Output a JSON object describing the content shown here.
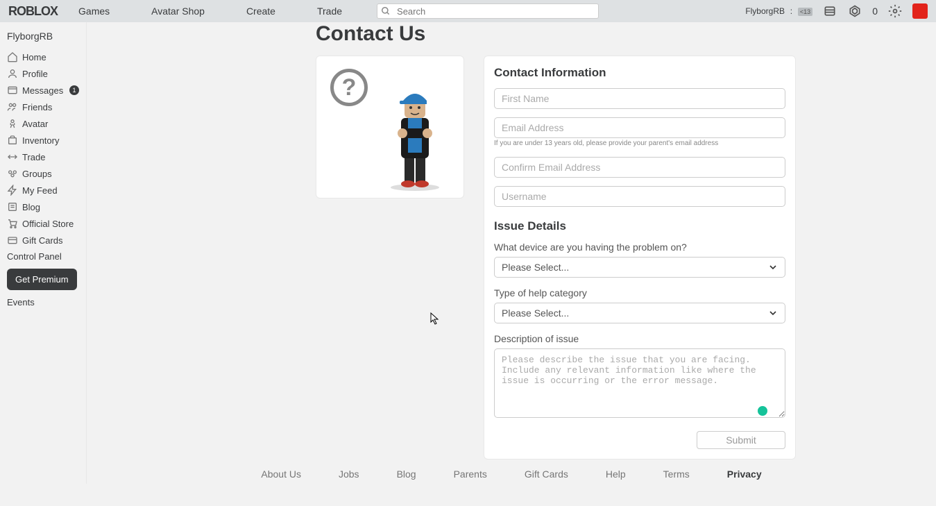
{
  "brand": "ROBLOX",
  "nav": {
    "links": [
      "Games",
      "Avatar Shop",
      "Create",
      "Trade"
    ],
    "search_placeholder": "Search",
    "username": "FlyborgRB",
    "age": "<13",
    "robux": "0"
  },
  "sidebar": {
    "username": "FlyborgRB",
    "items": [
      {
        "icon": "home-icon",
        "label": "Home"
      },
      {
        "icon": "profile-icon",
        "label": "Profile"
      },
      {
        "icon": "messages-icon",
        "label": "Messages",
        "badge": "1"
      },
      {
        "icon": "friends-icon",
        "label": "Friends"
      },
      {
        "icon": "avatar-icon",
        "label": "Avatar"
      },
      {
        "icon": "inventory-icon",
        "label": "Inventory"
      },
      {
        "icon": "trade-icon",
        "label": "Trade"
      },
      {
        "icon": "groups-icon",
        "label": "Groups"
      },
      {
        "icon": "feed-icon",
        "label": "My Feed"
      },
      {
        "icon": "blog-icon",
        "label": "Blog"
      },
      {
        "icon": "store-icon",
        "label": "Official Store"
      },
      {
        "icon": "giftcards-icon",
        "label": "Gift Cards"
      }
    ],
    "control_panel": "Control Panel",
    "premium_btn": "Get Premium",
    "events": "Events"
  },
  "page": {
    "title": "Contact Us"
  },
  "form": {
    "contact_head": "Contact Information",
    "first_name_ph": "First Name",
    "email_ph": "Email Address",
    "email_hint": "If you are under 13 years old, please provide your parent's email address",
    "confirm_email_ph": "Confirm Email Address",
    "username_ph": "Username",
    "issue_head": "Issue Details",
    "device_label": "What device are you having the problem on?",
    "select_placeholder": "Please Select...",
    "category_label": "Type of help category",
    "desc_label": "Description of issue",
    "desc_ph": "Please describe the issue that you are facing. Include any relevant information like where the issue is occurring or the error message.",
    "submit": "Submit"
  },
  "footer": {
    "links": [
      "About Us",
      "Jobs",
      "Blog",
      "Parents",
      "Gift Cards",
      "Help",
      "Terms",
      "Privacy"
    ]
  }
}
